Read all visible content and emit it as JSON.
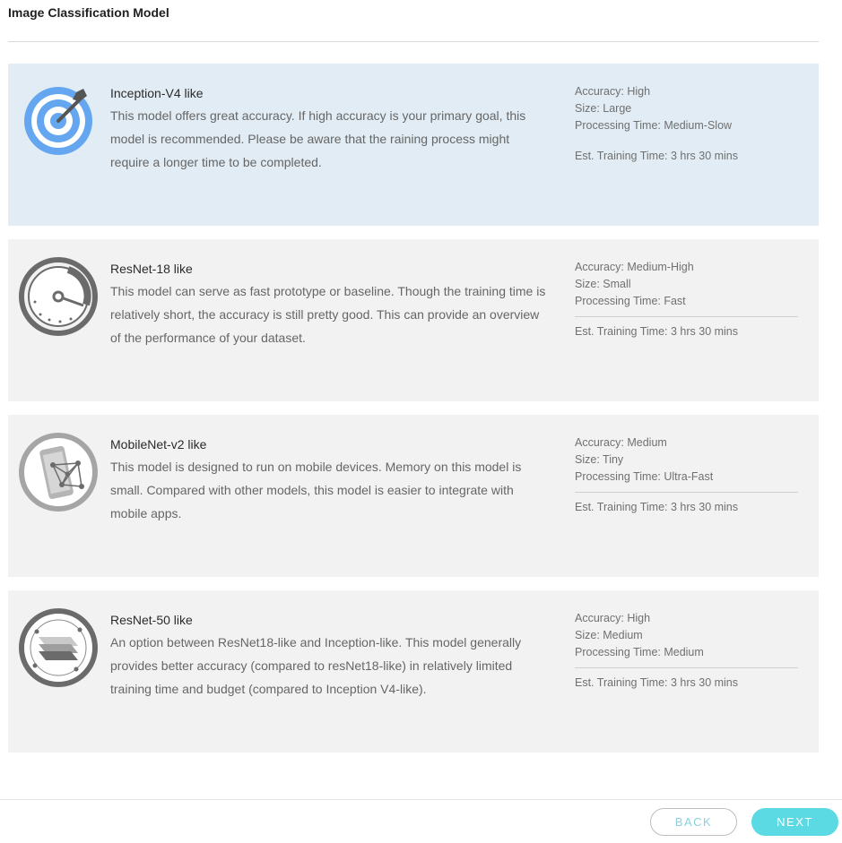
{
  "page": {
    "title": "Image Classification Model"
  },
  "models": [
    {
      "name": "Inception-V4 like",
      "description": "This model offers great accuracy. If high accuracy is your primary goal, this model is recommended. Please be aware that the raining process might require a longer time to be completed.",
      "accuracy": "Accuracy: High",
      "size": "Size: Large",
      "processing": "Processing Time: Medium-Slow",
      "training": "Est. Training Time: 3 hrs 30 mins",
      "icon": "target-icon",
      "selected": true
    },
    {
      "name": "ResNet-18 like",
      "description": "This model can serve as fast prototype or baseline. Though the training time is relatively short, the accuracy is still pretty good. This can provide an overview of the performance of your dataset.",
      "accuracy": "Accuracy: Medium-High",
      "size": "Size: Small",
      "processing": "Processing Time: Fast",
      "training": "Est. Training Time: 3 hrs 30 mins",
      "icon": "speedometer-icon",
      "selected": false
    },
    {
      "name": "MobileNet-v2 like",
      "description": "This model is designed to run on mobile devices. Memory on this model is small. Compared with other models, this model is easier to integrate with mobile apps.",
      "accuracy": "Accuracy: Medium",
      "size": "Size: Tiny",
      "processing": "Processing Time: Ultra-Fast",
      "training": "Est. Training Time: 3 hrs 30 mins",
      "icon": "mobile-network-icon",
      "selected": false
    },
    {
      "name": "ResNet-50 like",
      "description": "An option between ResNet18-like and Inception-like. This model generally provides better accuracy (compared to resNet18-like) in relatively limited training time and budget (compared to Inception V4-like).",
      "accuracy": "Accuracy: High",
      "size": "Size: Medium",
      "processing": "Processing Time: Medium",
      "training": "Est. Training Time: 3 hrs 30 mins",
      "icon": "layers-icon",
      "selected": false
    }
  ],
  "footer": {
    "back_label": "BACK",
    "next_label": "NEXT"
  },
  "colors": {
    "selected_card": "#e1ecf4",
    "card": "#f2f2f2",
    "accent": "#5bdae4",
    "icon_blue": "#64a7f0",
    "icon_gray": "#6b6b6b"
  }
}
